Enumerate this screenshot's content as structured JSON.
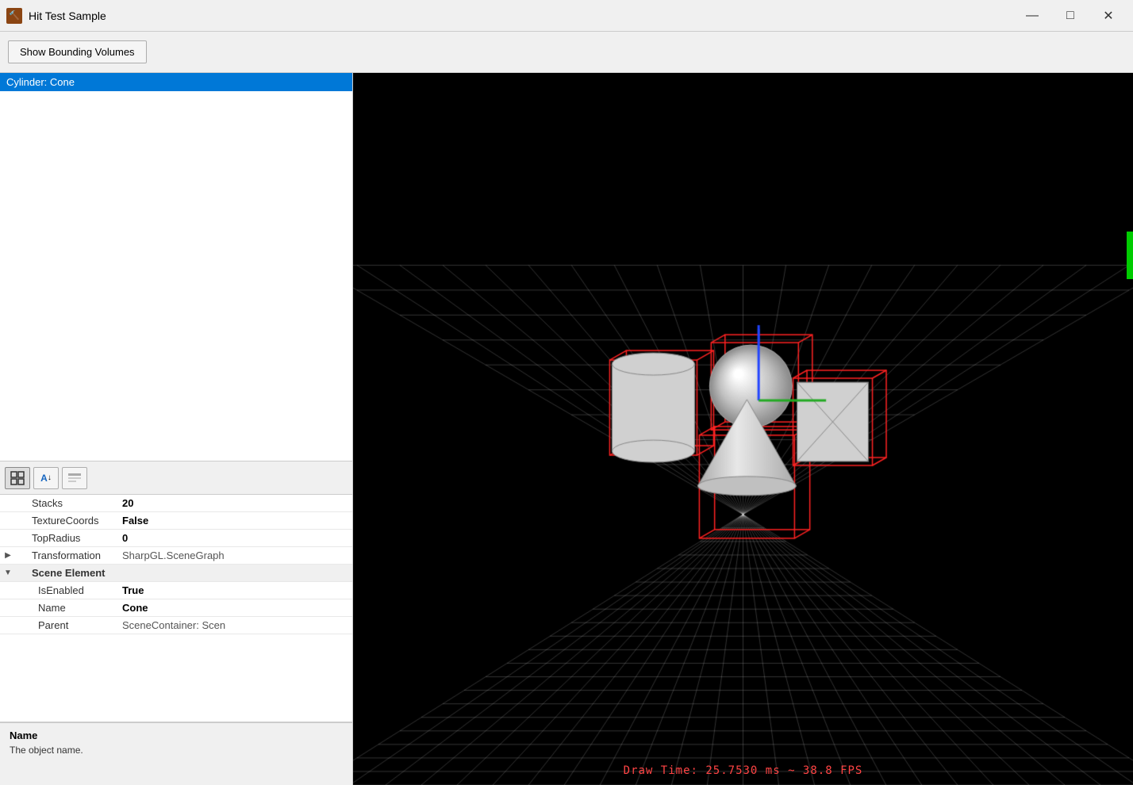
{
  "window": {
    "title": "Hit Test Sample",
    "icon_label": "🔨",
    "controls": {
      "minimize": "—",
      "maximize": "□",
      "close": "✕"
    }
  },
  "toolbar": {
    "show_bounding_btn": "Show Bounding Volumes"
  },
  "object_list": {
    "items": [
      {
        "label": "Cylinder: Cone",
        "selected": true
      }
    ]
  },
  "prop_toolbar": {
    "btn1_icon": "⊞",
    "btn2_icon": "AZ",
    "btn3_icon": "≡"
  },
  "properties": {
    "rows": [
      {
        "name": "Stacks",
        "value": "20",
        "bold": true,
        "expand": ""
      },
      {
        "name": "TextureCoords",
        "value": "False",
        "bold": true,
        "expand": ""
      },
      {
        "name": "TopRadius",
        "value": "0",
        "bold": true,
        "expand": ""
      },
      {
        "name": "Transformation",
        "value": "SharpGL.SceneGraph",
        "bold": false,
        "expand": "▶"
      },
      {
        "name": "Scene Element",
        "value": "",
        "bold": true,
        "isGroup": true,
        "expand": "▼"
      },
      {
        "name": "IsEnabled",
        "value": "True",
        "bold": true,
        "expand": "",
        "indent": true
      },
      {
        "name": "Name",
        "value": "Cone",
        "bold": true,
        "expand": "",
        "indent": true
      },
      {
        "name": "Parent",
        "value": "SceneContainer: Scen",
        "bold": false,
        "expand": "",
        "indent": true
      }
    ]
  },
  "description": {
    "title": "Name",
    "text": "The object name."
  },
  "viewport": {
    "status": "Draw Time: 25.7530 ms ~ 38.8 FPS"
  }
}
